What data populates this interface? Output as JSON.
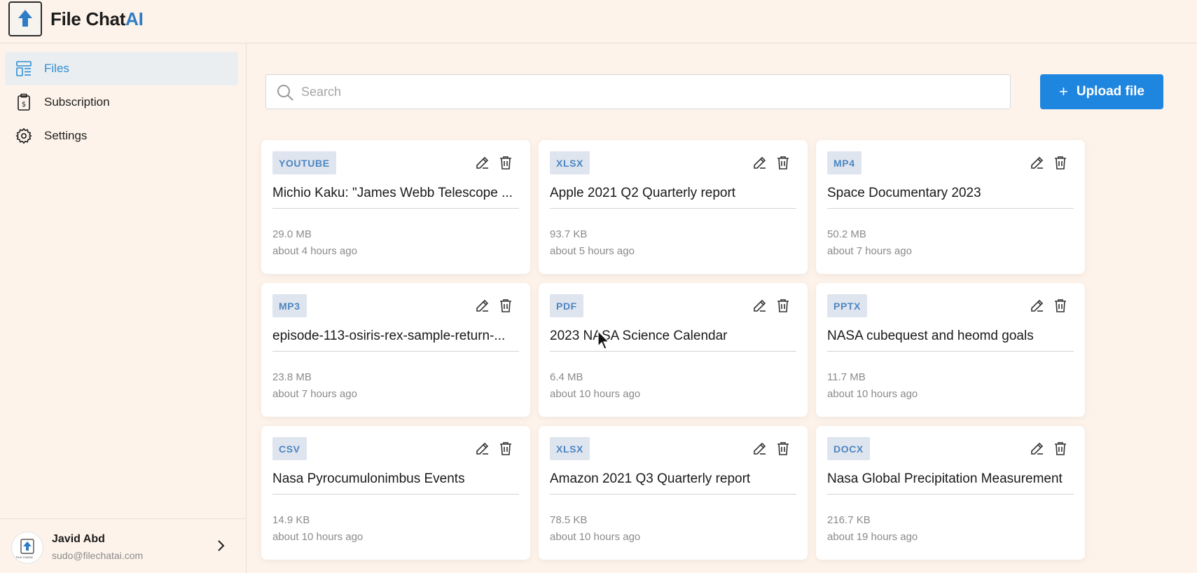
{
  "app": {
    "name_main": "File Chat",
    "name_accent": "AI"
  },
  "sidebar": {
    "items": [
      {
        "label": "Files",
        "icon": "files-icon",
        "active": true
      },
      {
        "label": "Subscription",
        "icon": "subscription-icon",
        "active": false
      },
      {
        "label": "Settings",
        "icon": "gear-icon",
        "active": false
      }
    ],
    "user": {
      "name": "Javid Abd",
      "email": "sudo@filechatai.com",
      "avatar_text": "FILE CHATAI"
    }
  },
  "toolbar": {
    "search_placeholder": "Search",
    "upload_label": "Upload file"
  },
  "files": [
    {
      "type": "YOUTUBE",
      "title": "Michio Kaku: \"James Webb Telescope ...",
      "size": "29.0 MB",
      "time": "about 4 hours ago"
    },
    {
      "type": "XLSX",
      "title": "Apple 2021 Q2 Quarterly report",
      "size": "93.7 KB",
      "time": "about 5 hours ago"
    },
    {
      "type": "MP4",
      "title": "Space Documentary 2023",
      "size": "50.2 MB",
      "time": "about 7 hours ago"
    },
    {
      "type": "MP3",
      "title": "episode-113-osiris-rex-sample-return-...",
      "size": "23.8 MB",
      "time": "about 7 hours ago"
    },
    {
      "type": "PDF",
      "title": "2023 NASA Science Calendar",
      "size": "6.4 MB",
      "time": "about 10 hours ago"
    },
    {
      "type": "PPTX",
      "title": "NASA cubequest and heomd goals",
      "size": "11.7 MB",
      "time": "about 10 hours ago"
    },
    {
      "type": "CSV",
      "title": "Nasa Pyrocumulonimbus Events",
      "size": "14.9 KB",
      "time": "about 10 hours ago"
    },
    {
      "type": "XLSX",
      "title": "Amazon 2021 Q3 Quarterly report",
      "size": "78.5 KB",
      "time": "about 10 hours ago"
    },
    {
      "type": "DOCX",
      "title": "Nasa Global Precipitation Measurement",
      "size": "216.7 KB",
      "time": "about 19 hours ago"
    }
  ],
  "colors": {
    "accent": "#1f86e0",
    "brand_ai": "#2f7cc6",
    "badge_bg": "#dfe5ee",
    "badge_text": "#4d86c2",
    "background": "#fdf3ea"
  }
}
